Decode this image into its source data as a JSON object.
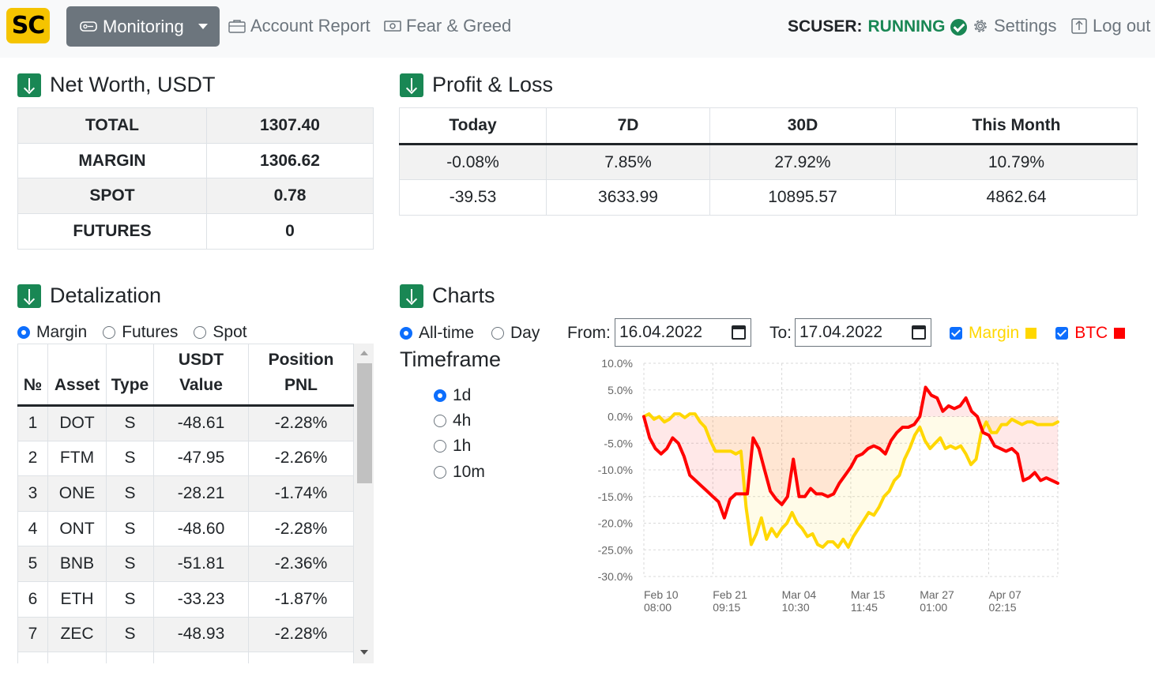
{
  "nav": {
    "logo": "SC",
    "monitoring": "Monitoring",
    "account_report": "Account Report",
    "fear_greed": "Fear & Greed",
    "user_label": "SCUSER:",
    "user_status": "RUNNING",
    "settings": "Settings",
    "logout": "Log out"
  },
  "networth": {
    "title": "Net Worth, USDT",
    "rows": [
      {
        "label": "TOTAL",
        "value": "1307.40"
      },
      {
        "label": "MARGIN",
        "value": "1306.62"
      },
      {
        "label": "SPOT",
        "value": "0.78"
      },
      {
        "label": "FUTURES",
        "value": "0"
      }
    ]
  },
  "pnl": {
    "title": "Profit & Loss",
    "headers": [
      "Today",
      "7D",
      "30D",
      "This Month"
    ],
    "percent": [
      "-0.08%",
      "7.85%",
      "27.92%",
      "10.79%"
    ],
    "absolute": [
      "-39.53",
      "3633.99",
      "10895.57",
      "4862.64"
    ]
  },
  "detalization": {
    "title": "Detalization",
    "options": [
      "Margin",
      "Futures",
      "Spot"
    ],
    "selected": "Margin",
    "headers": [
      "№",
      "Asset",
      "Type",
      "USDT Value",
      "Position PNL"
    ],
    "rows": [
      [
        "1",
        "DOT",
        "S",
        "-48.61",
        "-2.28%"
      ],
      [
        "2",
        "FTM",
        "S",
        "-47.95",
        "-2.26%"
      ],
      [
        "3",
        "ONE",
        "S",
        "-28.21",
        "-1.74%"
      ],
      [
        "4",
        "ONT",
        "S",
        "-48.60",
        "-2.28%"
      ],
      [
        "5",
        "BNB",
        "S",
        "-51.81",
        "-2.36%"
      ],
      [
        "6",
        "ETH",
        "S",
        "-33.23",
        "-1.87%"
      ],
      [
        "7",
        "ZEC",
        "S",
        "-48.93",
        "-2.28%"
      ]
    ]
  },
  "charts": {
    "title": "Charts",
    "range_options": [
      "All-time",
      "Day"
    ],
    "range_selected": "All-time",
    "from_label": "From:",
    "from_value": "16.04.2022",
    "to_label": "To:",
    "to_value": "17.04.2022",
    "legend_margin": "Margin",
    "legend_btc": "BTC",
    "timeframe_title": "Timeframe",
    "timeframes": [
      "1d",
      "4h",
      "1h",
      "10m"
    ],
    "timeframe_selected": "1d",
    "colors": {
      "margin": "#ffd700",
      "btc": "#ff0000",
      "accent": "#0d6efd",
      "success": "#198754"
    }
  },
  "chart_data": {
    "type": "line",
    "title": "",
    "ylim": [
      -30,
      10
    ],
    "yticks": [
      "10.0%",
      "5.0%",
      "0.0%",
      "-5.0%",
      "-10.0%",
      "-15.0%",
      "-20.0%",
      "-25.0%",
      "-30.0%"
    ],
    "xticks": [
      [
        "Feb 10",
        "08:00"
      ],
      [
        "Feb 21",
        "09:15"
      ],
      [
        "Mar 04",
        "10:30"
      ],
      [
        "Mar 15",
        "11:45"
      ],
      [
        "Mar 27",
        "01:00"
      ],
      [
        "Apr 07",
        "02:15"
      ]
    ],
    "grid": true,
    "series": [
      {
        "name": "Margin",
        "color": "#ffd700",
        "values": [
          0,
          0.5,
          -0.5,
          0,
          -1,
          -0.5,
          0.5,
          0.5,
          -0.2,
          0.5,
          0.5,
          -1,
          -2,
          -4.5,
          -6.5,
          -6.5,
          -6.5,
          -6.5,
          -7,
          -6.5,
          -17,
          -24,
          -22,
          -19,
          -23,
          -21,
          -22.5,
          -21,
          -20,
          -18,
          -20,
          -21,
          -22.5,
          -22,
          -24,
          -24.5,
          -23.5,
          -23.5,
          -24.5,
          -23,
          -24.5,
          -22.5,
          -21,
          -19.5,
          -18,
          -18.5,
          -17,
          -15,
          -14,
          -12,
          -11,
          -8,
          -6,
          -3.5,
          -2,
          -4.5,
          -6,
          -5,
          -4,
          -6,
          -5.5,
          -6,
          -5.5,
          -7,
          -9,
          -8,
          -3,
          -1,
          -3,
          -3,
          -1.5,
          -1.5,
          -0.5,
          -1,
          -1.5,
          -1,
          -1,
          -1.5,
          -1.5,
          -1.5,
          -1.5,
          -1
        ]
      },
      {
        "name": "BTC",
        "color": "#ff0000",
        "values": [
          0,
          -4,
          -6,
          -7,
          -6,
          -4,
          -5,
          -7.5,
          -11,
          -12,
          -13,
          -14,
          -15,
          -16,
          -19,
          -15.5,
          -14.5,
          -14.5,
          -14.5,
          -4,
          -6,
          -10,
          -14,
          -15.5,
          -16.5,
          -15,
          -8,
          -15,
          -15,
          -13.5,
          -14.5,
          -14.5,
          -15,
          -14.5,
          -12.5,
          -11,
          -9.5,
          -7.5,
          -7,
          -6,
          -5.5,
          -6,
          -7,
          -4.5,
          -3,
          -2,
          -2,
          -1.5,
          0,
          5.5,
          4,
          3.5,
          1,
          2,
          1.5,
          2,
          3.5,
          1,
          0,
          -3,
          -3.5,
          -5.5,
          -6,
          -6.5,
          -6,
          -7,
          -12,
          -11.5,
          -10.5,
          -12,
          -11.5,
          -12,
          -12.5
        ]
      }
    ]
  }
}
